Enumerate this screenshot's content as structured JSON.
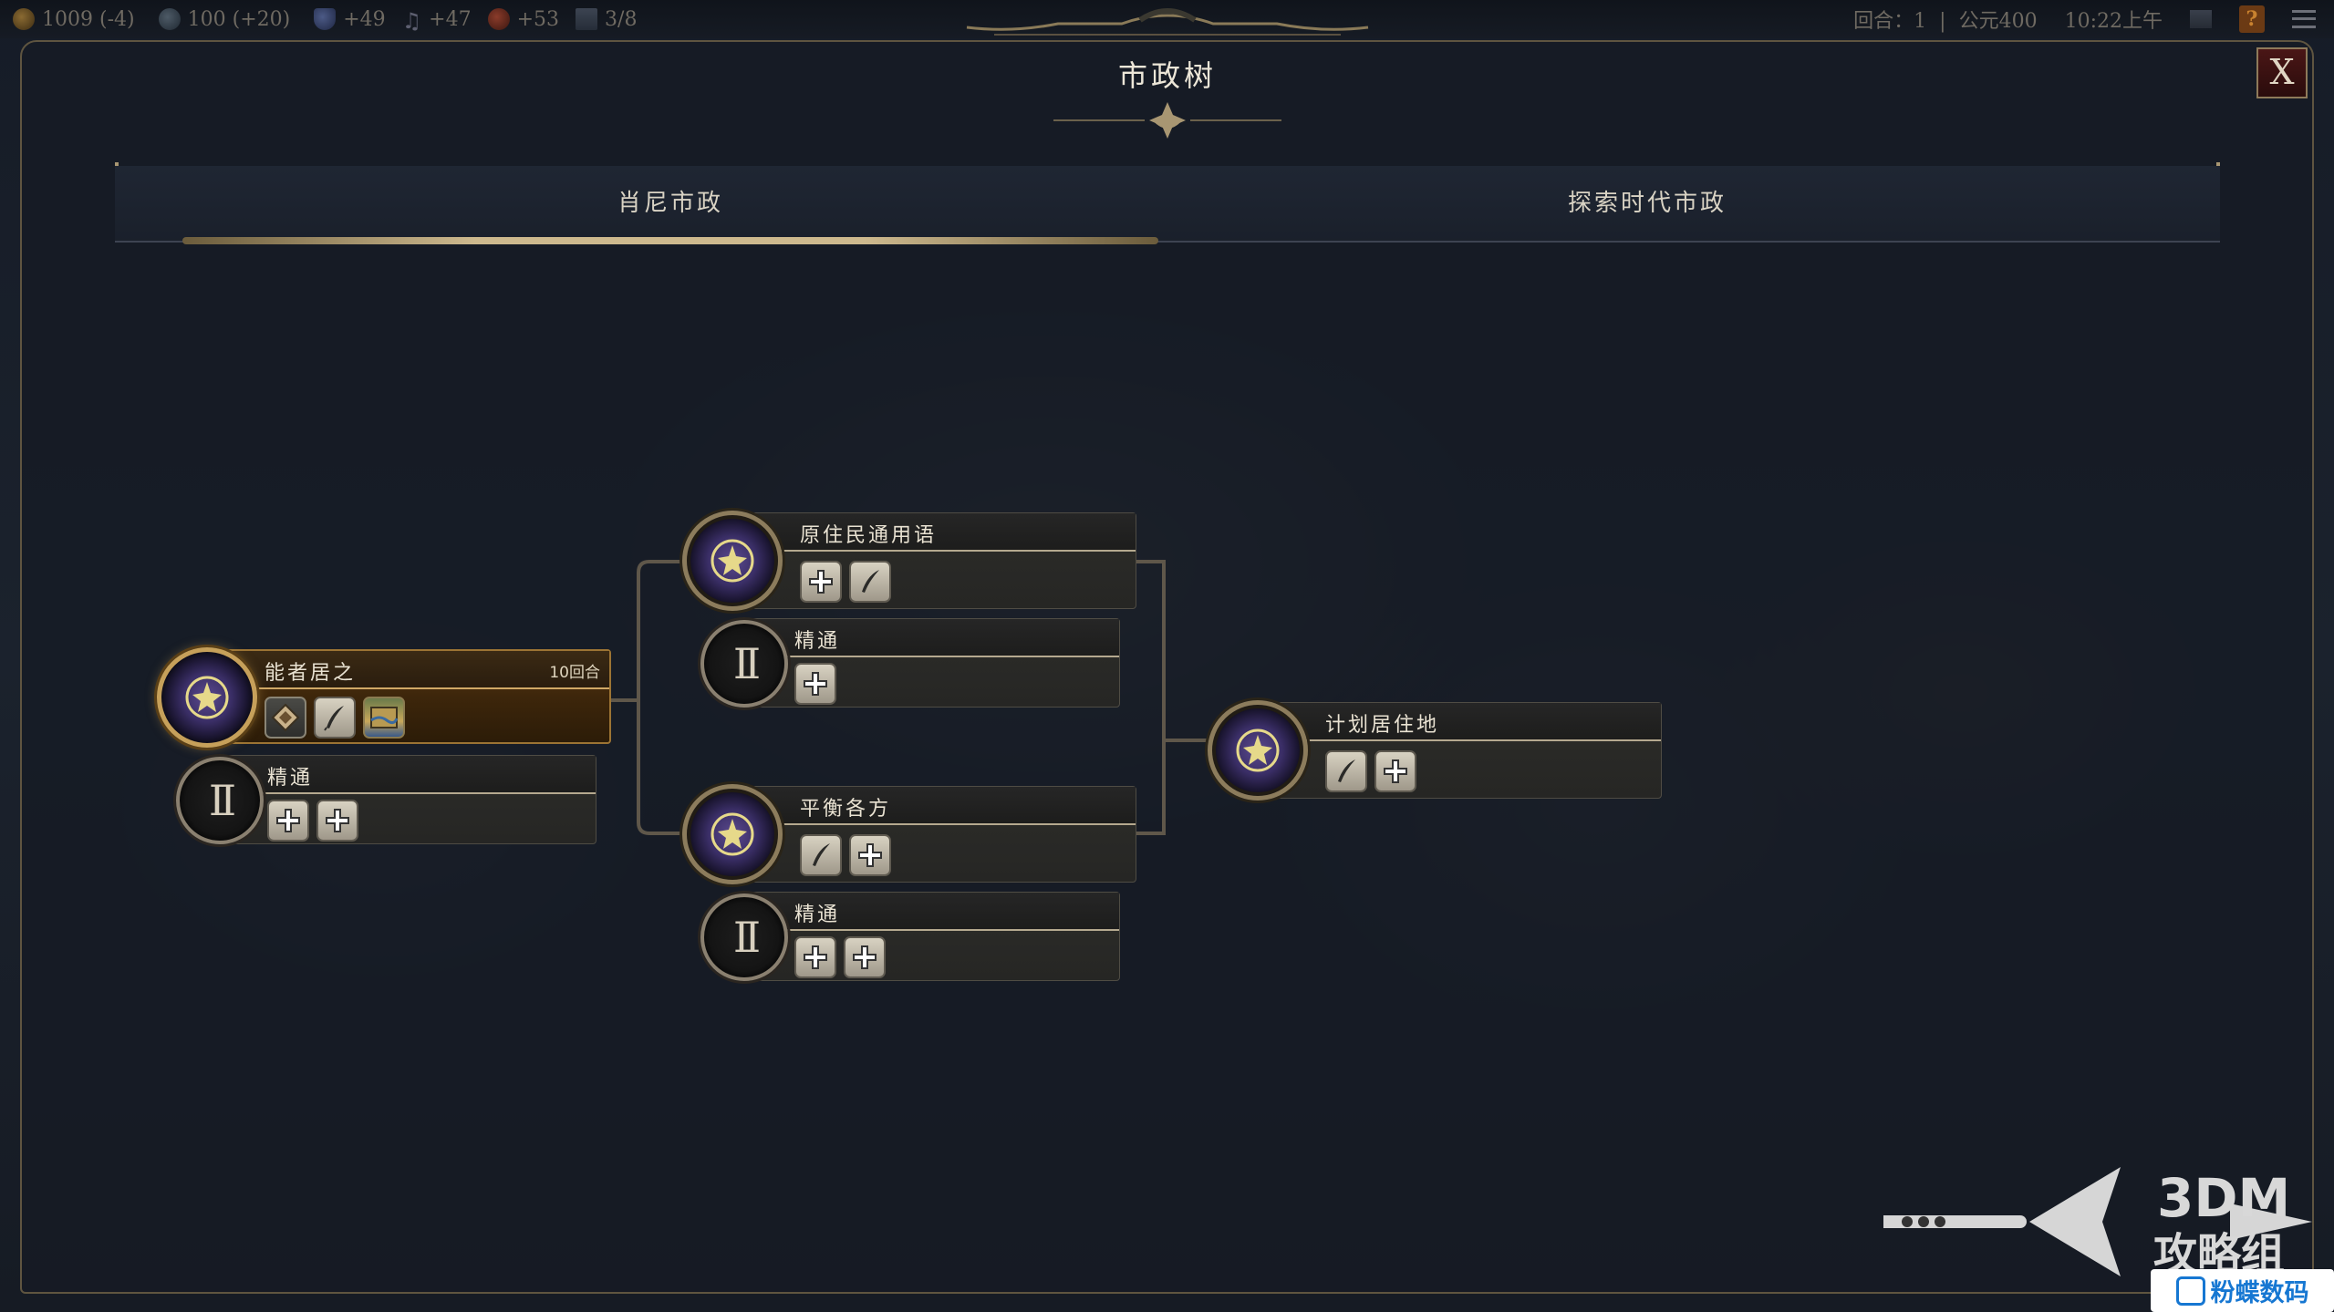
{
  "topbar": {
    "gold": "1009",
    "gold_delta": "(-4)",
    "science": "100",
    "science_delta": "(+20)",
    "culture": "+49",
    "music": "+47",
    "influence": "+53",
    "cities": "3/8",
    "turn": "回合：1",
    "separator": "|",
    "year": "公元400",
    "clock": "10:22上午",
    "help": "?"
  },
  "panel": {
    "title": "市政树",
    "close_label": "X"
  },
  "tabs": [
    {
      "label": "肖尼市政",
      "active": true
    },
    {
      "label": "探索时代市政",
      "active": false
    }
  ],
  "nodes": {
    "neng_zhe": {
      "name": "能者居之",
      "turns": "10回合",
      "status": "researching"
    },
    "neng_zhe_mastery": {
      "name": "精通"
    },
    "yuan_zhu_min": {
      "name": "原住民通用语"
    },
    "yuan_zhu_min_mastery": {
      "name": "精通"
    },
    "ping_heng": {
      "name": "平衡各方"
    },
    "ping_heng_mastery": {
      "name": "精通"
    },
    "ji_hua": {
      "name": "计划居住地"
    }
  },
  "mastery_numeral": "II",
  "icons": {
    "civic": "civic-crest-icon",
    "plus": "plus-icon",
    "quill": "quill-icon",
    "gem": "gem-icon",
    "map": "map-icon"
  },
  "colors": {
    "accent_gold": "#c6a05a",
    "active_card": "#5a3810",
    "civic_purple": "#3a2e66",
    "tab_underline": "#cdb98e"
  },
  "watermark": {
    "brand_top": "3DM",
    "brand_bottom": "攻略组",
    "site": "粉蝶数码"
  }
}
